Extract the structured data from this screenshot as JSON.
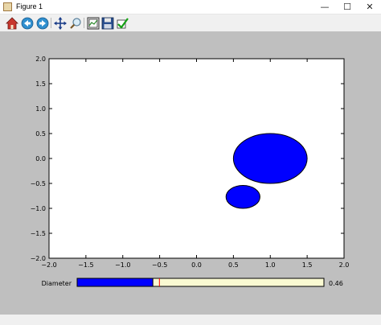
{
  "window": {
    "title": "Figure 1",
    "minimize_glyph": "—",
    "maximize_glyph": "☐",
    "close_glyph": "✕"
  },
  "toolbar": {
    "buttons": [
      {
        "name": "home-icon"
      },
      {
        "name": "back-icon"
      },
      {
        "name": "forward-icon"
      },
      {
        "name": "pan-icon"
      },
      {
        "name": "zoom-icon"
      },
      {
        "name": "configure-subplots-icon"
      },
      {
        "name": "save-icon"
      },
      {
        "name": "edit-axes-icon"
      }
    ]
  },
  "chart_data": {
    "type": "scatter",
    "title": "",
    "xlabel": "",
    "ylabel": "",
    "xlim": [
      -2.0,
      2.0
    ],
    "ylim": [
      -2.0,
      2.0
    ],
    "xticks": [
      "−2.0",
      "−1.5",
      "−1.0",
      "−0.5",
      "0.0",
      "0.5",
      "1.0",
      "1.5",
      "2.0"
    ],
    "yticks": [
      "−2.0",
      "−1.5",
      "−1.0",
      "−0.5",
      "0.0",
      "0.5",
      "1.0",
      "1.5",
      "2.0"
    ],
    "grid": false,
    "ellipses": [
      {
        "cx": 1.0,
        "cy": 0.0,
        "width": 1.0,
        "height": 1.0,
        "color": "#0000ff"
      },
      {
        "cx": 0.63,
        "cy": -0.77,
        "width": 0.46,
        "height": 0.46,
        "color": "#0000ff"
      }
    ]
  },
  "slider": {
    "label": "Diameter",
    "value": 0.46,
    "value_text": "0.46",
    "min": 0.0,
    "max": 1.5,
    "init": 0.5,
    "fill_color": "#0000ff",
    "track_color": "#fafad2",
    "init_line_color": "#ff0000"
  }
}
